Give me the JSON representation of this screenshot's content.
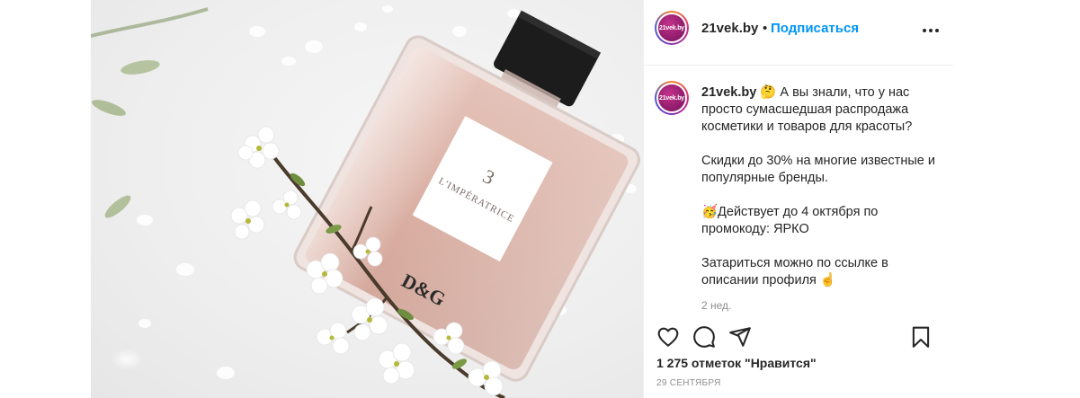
{
  "post": {
    "image_alt": "Perfume bottle with white blossom branch",
    "bottle_label_number": "3",
    "bottle_label_name": "L'IMPÉRATRICE",
    "bottle_brand_mark": "D&G"
  },
  "header": {
    "avatar_text": "21vek.by",
    "username": "21vek.by",
    "separator": "•",
    "follow_label": "Подписаться",
    "more_icon": "ellipsis-icon"
  },
  "caption": {
    "avatar_text": "21vek.by",
    "username": "21vek.by",
    "line1": "🤔 А вы знали, что у нас просто сумасшедшая распродажа косметики и товаров для красоты?",
    "line2": "Скидки до 30% на многие известные и популярные бренды.",
    "line3": "🥳Действует до 4 октября по промокоду: ЯРКО",
    "line4": "Затариться можно по ссылке в описании профиля ☝️",
    "time_ago": "2 нед."
  },
  "actions": {
    "like_icon": "heart-icon",
    "comment_icon": "comment-icon",
    "share_icon": "paper-plane-icon",
    "save_icon": "bookmark-icon"
  },
  "stats": {
    "likes_text": "1 275 отметок \"Нравится\"",
    "date_text": "29 СЕНТЯБРЯ"
  },
  "colors": {
    "link_blue": "#0095f6",
    "text_dark": "#262626",
    "text_muted": "#8e8e8e",
    "divider": "#efefef"
  }
}
